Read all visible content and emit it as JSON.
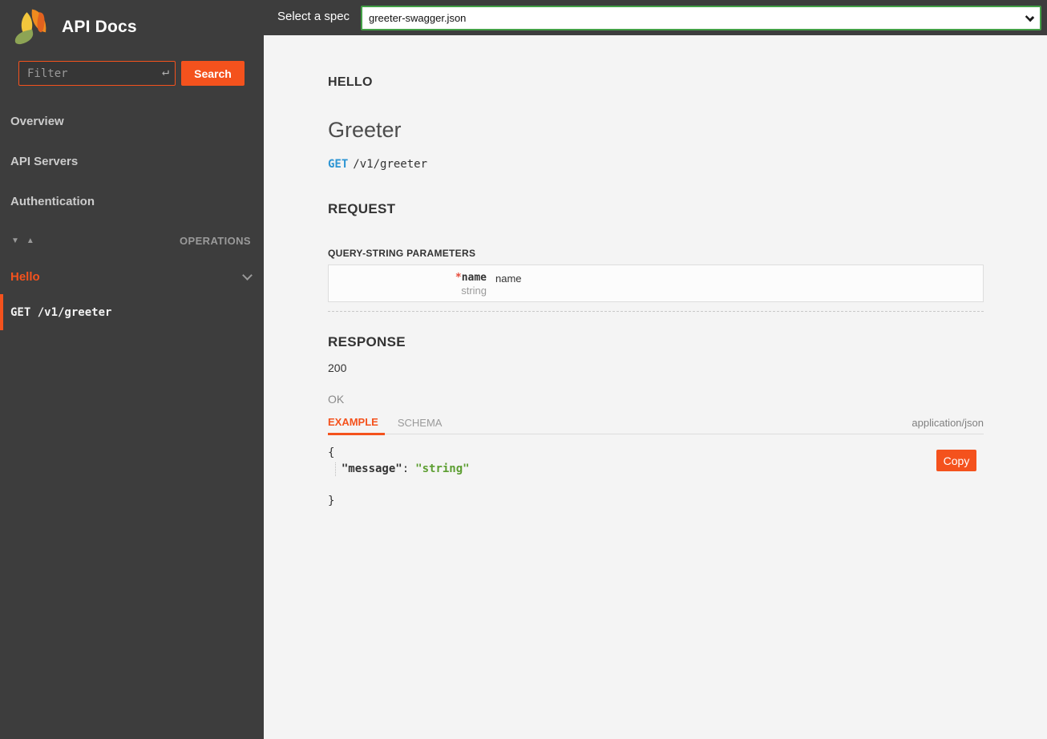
{
  "app": {
    "title": "API Docs"
  },
  "colors": {
    "accent_orange": "#f4521d",
    "select_border_green": "#43a047",
    "sidebar_bg": "#3d3d3d",
    "main_bg": "#f4f4f4",
    "method_blue": "#2d95d3",
    "json_string_green": "#5c9e31",
    "required_red": "#e74c3c"
  },
  "topbar": {
    "label": "Select a spec",
    "spec_selected": "greeter-swagger.json"
  },
  "sidebar": {
    "filter": {
      "placeholder": "Filter",
      "enter_icon": "↵"
    },
    "search_label": "Search",
    "items": [
      {
        "label": "Overview"
      },
      {
        "label": "API Servers"
      },
      {
        "label": "Authentication"
      }
    ],
    "operations": {
      "label": "OPERATIONS",
      "collapse_icon": "▼",
      "expand_icon": "▲"
    },
    "groups": [
      {
        "label": "Hello",
        "endpoints": [
          {
            "label": "GET /v1/greeter",
            "selected": true
          }
        ]
      }
    ]
  },
  "main": {
    "section_tag": "HELLO",
    "title": "Greeter",
    "endpoint": {
      "method": "GET",
      "path": "/v1/greeter"
    },
    "request": {
      "heading": "REQUEST",
      "query_heading": "QUERY-STRING PARAMETERS",
      "params": [
        {
          "required_marker": "*",
          "name": "name",
          "type": "string",
          "description": "name"
        }
      ]
    },
    "response": {
      "heading": "RESPONSE",
      "status_code": "200",
      "status_text": "OK",
      "tabs": [
        {
          "label": "EXAMPLE",
          "active": true
        },
        {
          "label": "SCHEMA",
          "active": false
        }
      ],
      "content_type": "application/json",
      "example": {
        "open_brace": "{",
        "key": "\"message\"",
        "separator": ":",
        "value": "\"string\"",
        "close_brace": "}"
      },
      "copy_label": "Copy"
    }
  }
}
